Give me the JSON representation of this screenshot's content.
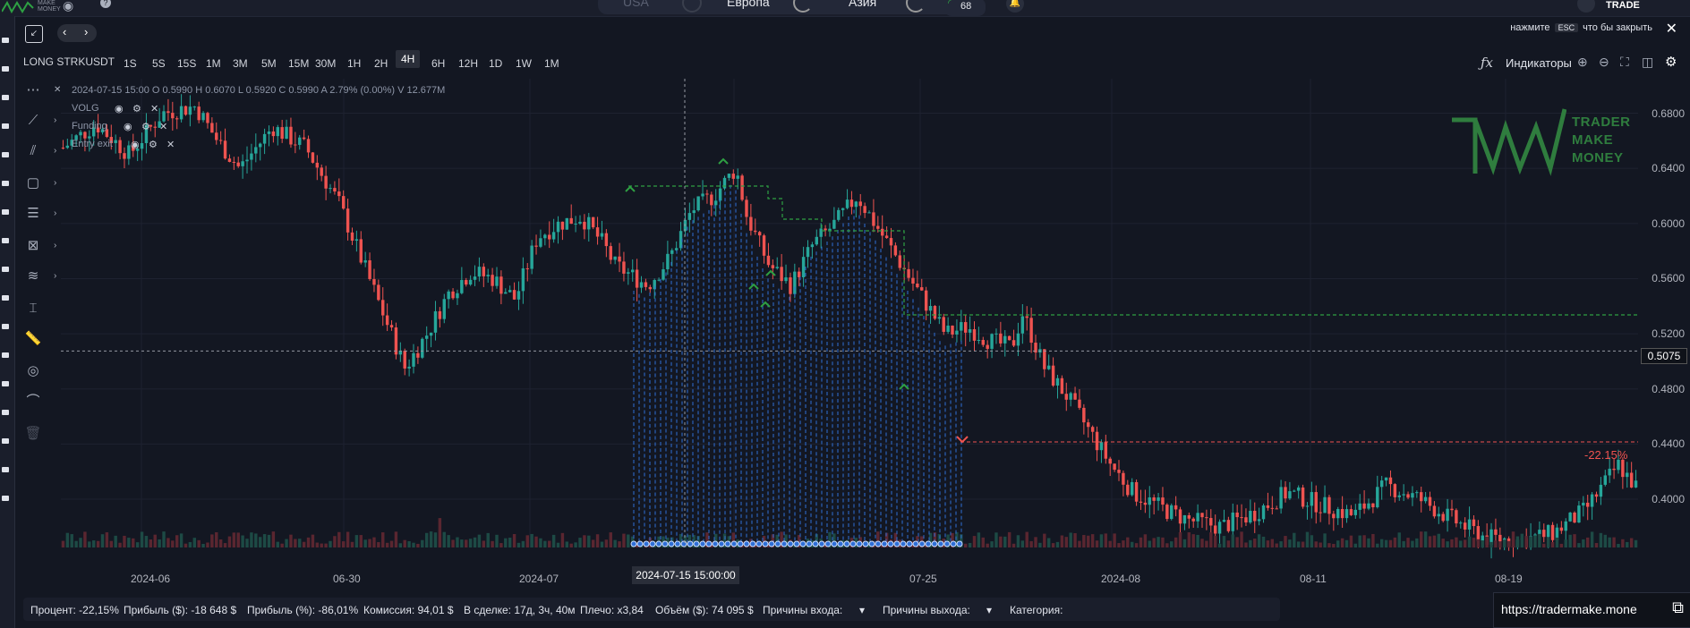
{
  "topbar": {
    "brand": "MAKE MONEY",
    "markets": [
      "USA",
      "Европа",
      "Азия"
    ],
    "gauge_value": "68",
    "trade_label": "TRADE"
  },
  "overlay": {
    "esc_prefix": "нажмите",
    "esc_key": "ESC",
    "esc_suffix": "что бы закрыть"
  },
  "toolbar": {
    "symbol": "LONG STRKUSDT",
    "timeframes": [
      "1S",
      "5S",
      "15S",
      "1M",
      "3M",
      "5M",
      "15M",
      "30M",
      "1H",
      "2H",
      "4H",
      "6H",
      "12H",
      "1D",
      "1W",
      "1M"
    ],
    "active_timeframe": "4H",
    "indicators_label": "Индикаторы"
  },
  "legend": {
    "ohlc": "2024-07-15 15:00     O 0.5990     H 0.6070     L 0.5920     C 0.5990     A 2.79%     (0.00%)     V 12.677M",
    "indicators": [
      "VOLG",
      "Funding",
      "Entry exit"
    ]
  },
  "logo": {
    "lines": [
      "TRADER",
      "MAKE",
      "MONEY"
    ]
  },
  "chart_data": {
    "type": "candlestick",
    "title": "",
    "symbol": "STRKUSDT",
    "interval": "4H",
    "y_ticks": [
      "0.6800",
      "0.6400",
      "0.6000",
      "0.5600",
      "0.5200",
      "0.4800",
      "0.4400",
      "0.4000"
    ],
    "ylim": [
      0.365,
      0.705
    ],
    "x_ticks": [
      "2024-06",
      "06-30",
      "2024-07",
      "07",
      "07-25",
      "2024-08",
      "08-11",
      "08-19"
    ],
    "crosshair_price": "0.5075",
    "crosshair_time": "2024-07-15 15:00:00",
    "trade_result_label": "-22.15%",
    "price_path": [
      {
        "t": 0.0,
        "p": 0.655
      },
      {
        "t": 0.03,
        "p": 0.672
      },
      {
        "t": 0.06,
        "p": 0.65
      },
      {
        "t": 0.09,
        "p": 0.68
      },
      {
        "t": 0.12,
        "p": 0.685
      },
      {
        "t": 0.14,
        "p": 0.66
      },
      {
        "t": 0.16,
        "p": 0.64
      },
      {
        "t": 0.19,
        "p": 0.67
      },
      {
        "t": 0.22,
        "p": 0.655
      },
      {
        "t": 0.25,
        "p": 0.615
      },
      {
        "t": 0.27,
        "p": 0.575
      },
      {
        "t": 0.31,
        "p": 0.495
      },
      {
        "t": 0.33,
        "p": 0.52
      },
      {
        "t": 0.35,
        "p": 0.55
      },
      {
        "t": 0.37,
        "p": 0.565
      },
      {
        "t": 0.39,
        "p": 0.56
      },
      {
        "t": 0.41,
        "p": 0.545
      },
      {
        "t": 0.43,
        "p": 0.59
      },
      {
        "t": 0.45,
        "p": 0.6
      },
      {
        "t": 0.47,
        "p": 0.605
      },
      {
        "t": 0.49,
        "p": 0.585
      },
      {
        "t": 0.5,
        "p": 0.57
      },
      {
        "t": 0.53,
        "p": 0.555
      },
      {
        "t": 0.55,
        "p": 0.575
      },
      {
        "t": 0.57,
        "p": 0.61
      },
      {
        "t": 0.59,
        "p": 0.62
      },
      {
        "t": 0.61,
        "p": 0.64
      },
      {
        "t": 0.62,
        "p": 0.605
      },
      {
        "t": 0.64,
        "p": 0.57
      },
      {
        "t": 0.66,
        "p": 0.555
      },
      {
        "t": 0.68,
        "p": 0.585
      },
      {
        "t": 0.7,
        "p": 0.6
      },
      {
        "t": 0.72,
        "p": 0.62
      },
      {
        "t": 0.74,
        "p": 0.595
      },
      {
        "t": 0.76,
        "p": 0.57
      },
      {
        "t": 0.78,
        "p": 0.545
      },
      {
        "t": 0.8,
        "p": 0.52
      },
      {
        "t": 0.82,
        "p": 0.525
      },
      {
        "t": 0.84,
        "p": 0.515
      },
      {
        "t": 0.86,
        "p": 0.51
      },
      {
        "t": 0.87,
        "p": 0.535
      },
      {
        "t": 0.89,
        "p": 0.495
      },
      {
        "t": 0.91,
        "p": 0.475
      },
      {
        "t": 0.93,
        "p": 0.45
      },
      {
        "t": 0.95,
        "p": 0.425
      },
      {
        "t": 0.97,
        "p": 0.405
      },
      {
        "t": 1.0,
        "p": 0.392
      }
    ],
    "price_path_tail": [
      {
        "t": 1.02,
        "p": 0.385
      },
      {
        "t": 1.05,
        "p": 0.38
      },
      {
        "t": 1.08,
        "p": 0.39
      },
      {
        "t": 1.11,
        "p": 0.405
      },
      {
        "t": 1.14,
        "p": 0.396
      },
      {
        "t": 1.17,
        "p": 0.388
      },
      {
        "t": 1.2,
        "p": 0.41
      },
      {
        "t": 1.23,
        "p": 0.4
      },
      {
        "t": 1.26,
        "p": 0.385
      },
      {
        "t": 1.29,
        "p": 0.372
      },
      {
        "t": 1.32,
        "p": 0.37
      },
      {
        "t": 1.35,
        "p": 0.375
      },
      {
        "t": 1.38,
        "p": 0.392
      },
      {
        "t": 1.41,
        "p": 0.425
      },
      {
        "t": 1.43,
        "p": 0.405
      }
    ]
  },
  "stats": {
    "percent": "Процент: -22,15%",
    "profit_usd": "Прибыль ($): -18 648 $",
    "profit_pct": "Прибыль (%): -86,01%",
    "commission": "Комиссия: 94,01 $",
    "in_trade": "В сделке: 17д, 3ч, 40м",
    "leverage": "Плечо: x3,84",
    "volume": "Объём ($): 74 095 $",
    "entry_reasons": "Причины входа:",
    "exit_reasons": "Причины выхода:",
    "category": "Категория:"
  },
  "url": "https://tradermake.mone",
  "colors": {
    "bg": "#131722",
    "up": "#26a69a",
    "down": "#ef5350",
    "stop": "#2ea043",
    "grid": "#1e2230"
  }
}
